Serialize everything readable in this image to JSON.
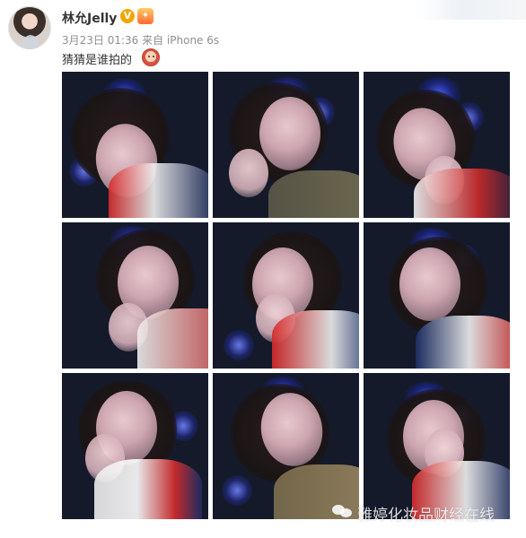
{
  "post": {
    "user_name": "林允Jelly",
    "verified_icon": "verified-badge-icon",
    "badge_icon": "vip-badge-icon",
    "meta": "3月23日 01:36 来自 iPhone 6s",
    "text": "猜猜是谁拍的",
    "emoji_icon": "cute-face-emoji-icon"
  },
  "gallery": {
    "photos": [
      {
        "id": "photo-1"
      },
      {
        "id": "photo-2"
      },
      {
        "id": "photo-3"
      },
      {
        "id": "photo-4"
      },
      {
        "id": "photo-5"
      },
      {
        "id": "photo-6"
      },
      {
        "id": "photo-7"
      },
      {
        "id": "photo-8"
      },
      {
        "id": "photo-9"
      }
    ]
  },
  "watermark": {
    "text": "雅婷化妆品财经在线",
    "icon": "wechat-icon"
  },
  "colors": {
    "accent": "#f0a800",
    "text": "#333333",
    "meta": "#8f8f8f"
  }
}
